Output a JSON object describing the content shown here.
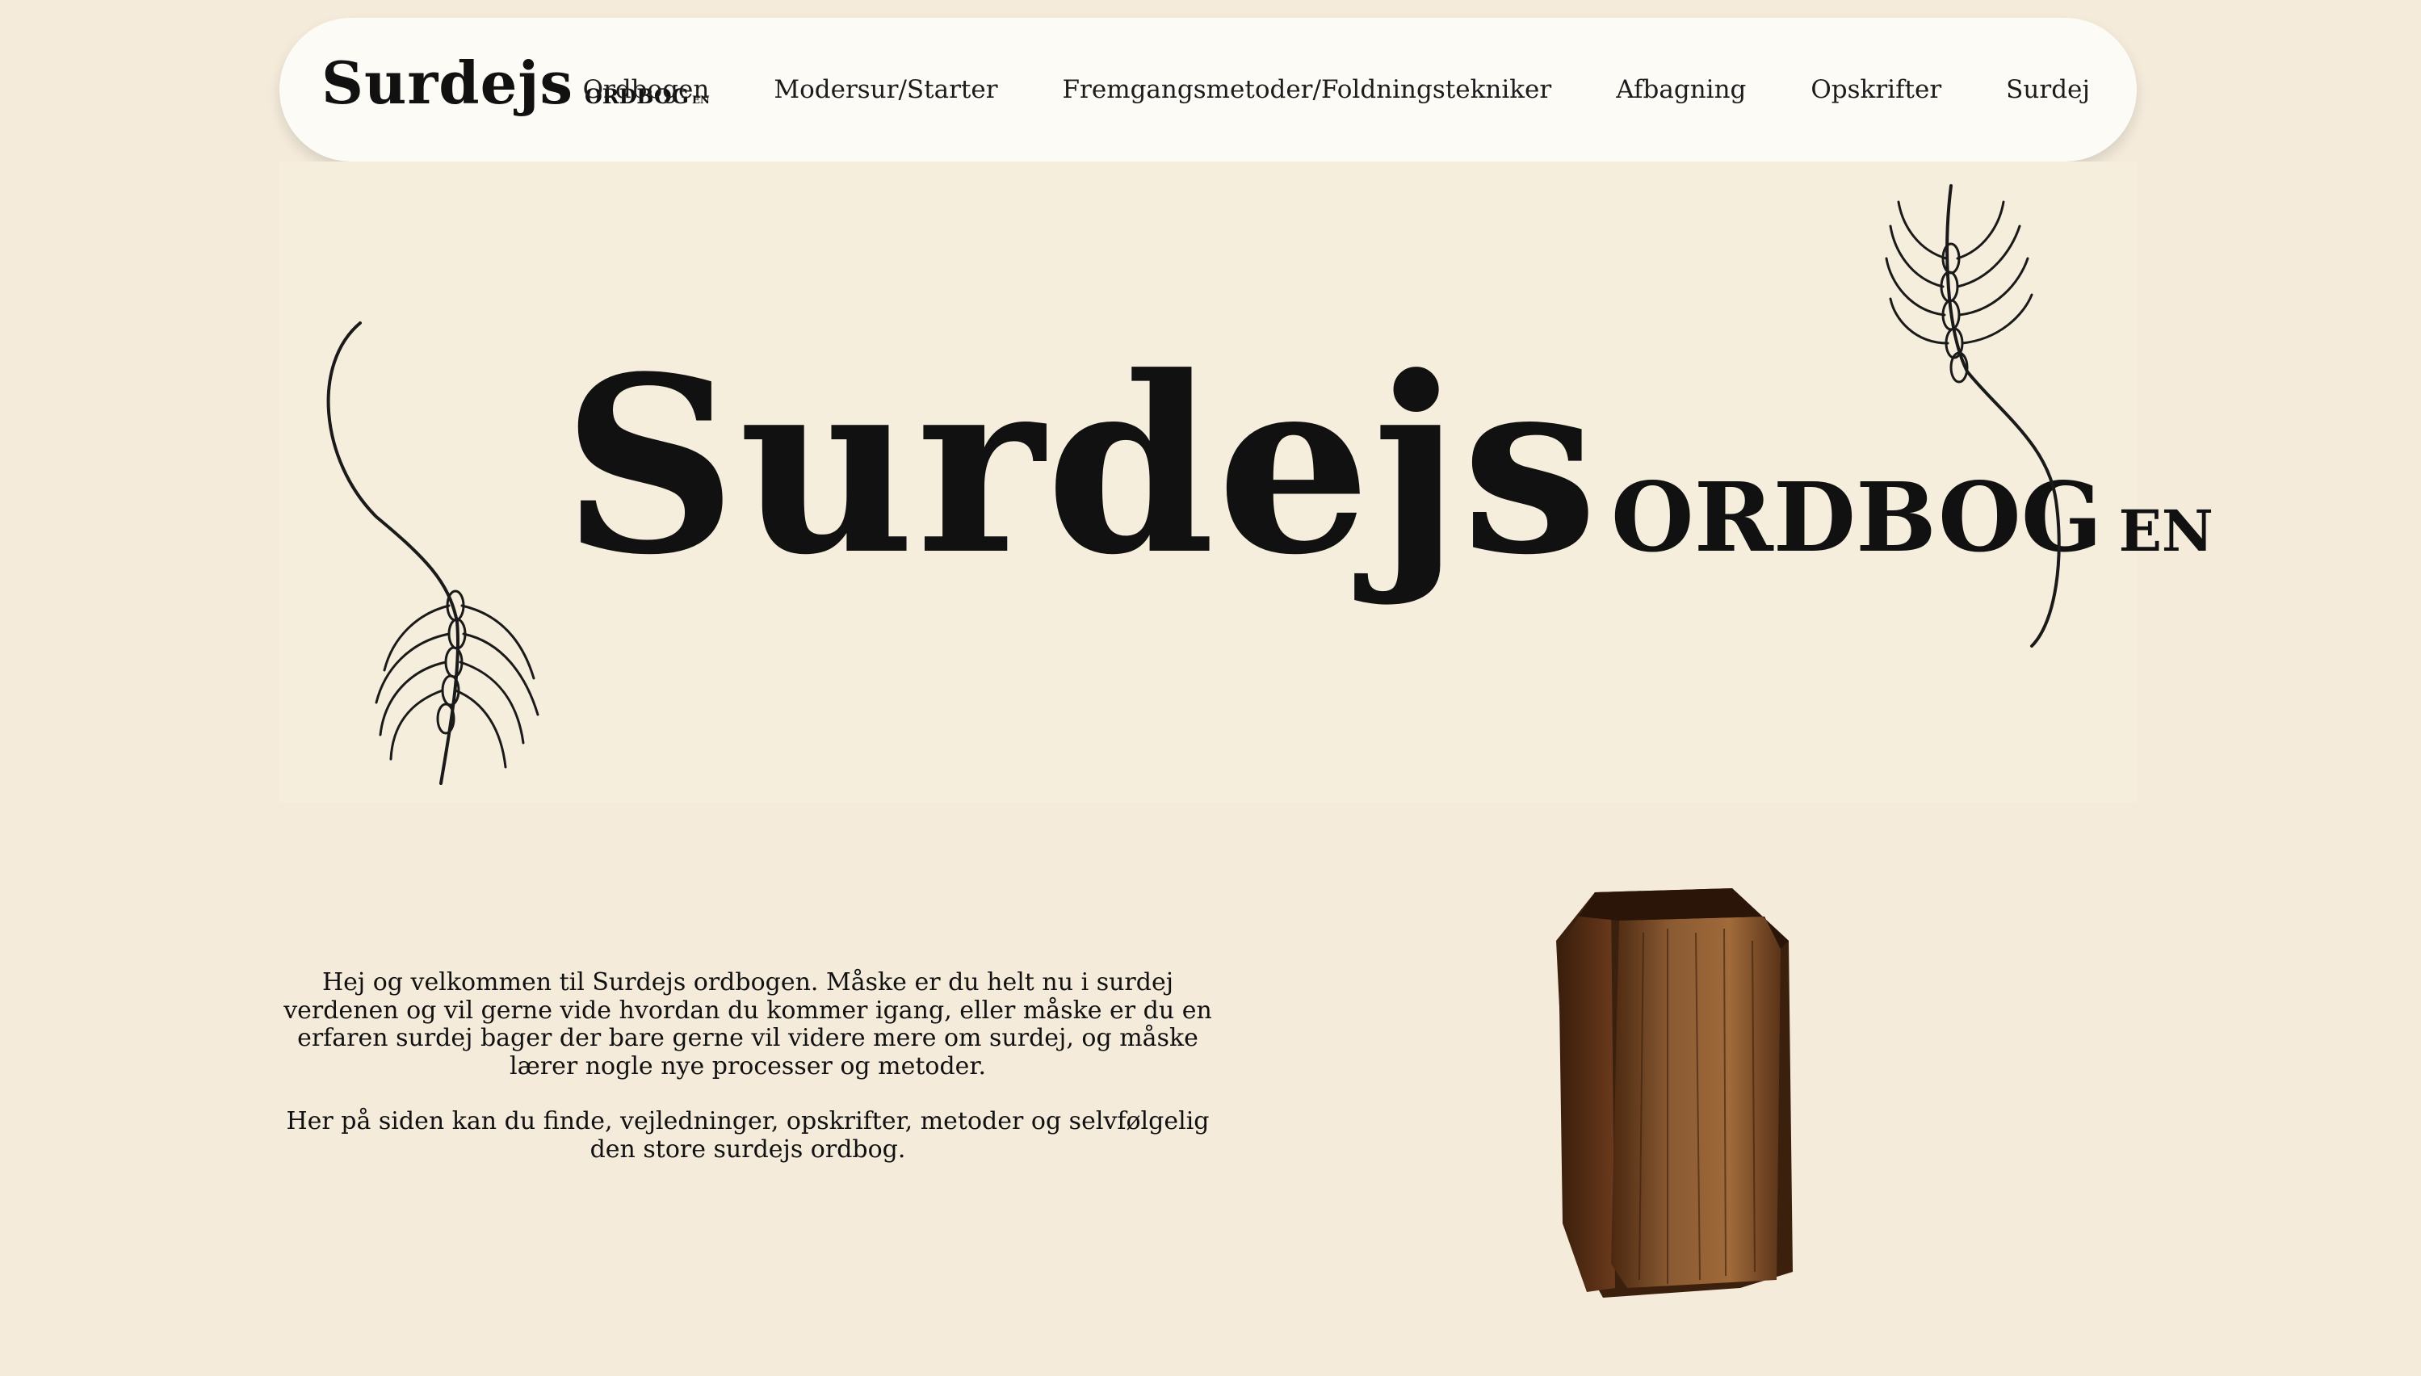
{
  "header": {
    "brand_main": "Surdejs",
    "brand_sub": "ORDBOG",
    "brand_en": "EN",
    "nav": [
      "Ordbogen",
      "Modersur/Starter",
      "Fremgangsmetoder/Foldningstekniker",
      "Afbagning",
      "Opskrifter",
      "Surdej"
    ]
  },
  "hero": {
    "title": "Surdejs",
    "subtitle": "ORDBOG",
    "lang": "EN"
  },
  "intro": {
    "paragraph1": "Hej og velkommen til Surdejs ordbogen. Måske er du helt nu i surdej verdenen og vil gerne vide hvordan du kommer igang, eller måske er du en erfaren surdej bager der bare gerne vil videre mere om surdej, og måske lærer nogle nye processer og metoder.",
    "paragraph2": "Her på siden kan du finde, vejledninger, opskrifter, metoder og selvfølgelig den store surdejs ordbog."
  },
  "colors": {
    "background": "#f4ebdb",
    "navbar": "#fcfbf6",
    "text": "#111111",
    "book_brown": "#6b3a1c"
  }
}
